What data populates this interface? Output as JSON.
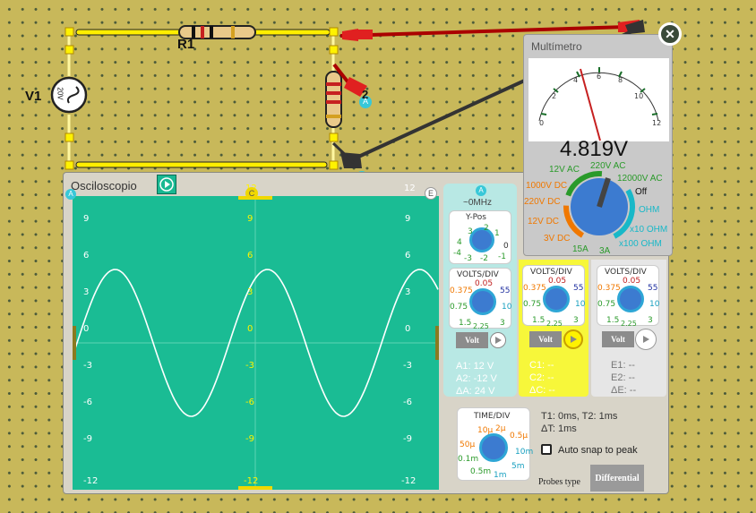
{
  "circuit": {
    "source": {
      "name": "V1",
      "value": "20V"
    },
    "resistor1": {
      "name": "R1"
    },
    "resistor2": {
      "name_partial": "2"
    },
    "probe_label": "A"
  },
  "oscilloscope": {
    "title": "Osciloscopio",
    "screen": {
      "left_ticks": [
        "9",
        "6",
        "3",
        "0",
        "-3",
        "-6",
        "-9",
        "-12"
      ],
      "center_ticks": [
        "12",
        "9",
        "6",
        "3",
        "0",
        "-3",
        "-6",
        "-9",
        "-12"
      ],
      "right_ticks": [
        "12",
        "9",
        "6",
        "3",
        "0",
        "-3",
        "-6",
        "-9",
        "-12"
      ],
      "left_marker": "A",
      "center_marker": "C",
      "right_marker": "E"
    },
    "channel_a": {
      "label": "A",
      "freq": "~0MHz",
      "ypos_title": "Y-Pos",
      "ypos_ticks": [
        "3",
        "2",
        "1",
        "4",
        "0",
        "-4",
        "-3",
        "-2",
        "-1"
      ],
      "volts_title": "VOLTS/DIV",
      "volts_ticks": [
        "0.05",
        "0.375",
        "55",
        "0.75",
        "10",
        "1.5",
        "2.25",
        "3"
      ],
      "btn": "Volt",
      "m1": "A1: 12 V",
      "m2": "A2: -12 V",
      "m3": "ΔA: 24 V"
    },
    "channel_c": {
      "volts_title": "VOLTS/DIV",
      "volts_ticks": [
        "0.05",
        "0.375",
        "55",
        "0.75",
        "10",
        "1.5",
        "2.25",
        "3"
      ],
      "btn": "Volt",
      "m1": "C1: --",
      "m2": "C2: --",
      "m3": "ΔC: --"
    },
    "channel_e": {
      "volts_title": "VOLTS/DIV",
      "volts_ticks": [
        "0.05",
        "0.375",
        "55",
        "0.75",
        "10",
        "1.5",
        "2.25",
        "3"
      ],
      "btn": "Volt",
      "m1": "E1: --",
      "m2": "E2: --",
      "m3": "ΔE: --"
    },
    "time": {
      "title": "TIME/DIV",
      "ticks": [
        "10µ",
        "2µ",
        "0.5µ",
        "50µ",
        "10m",
        "0.1m",
        "5m",
        "0.5m",
        "1m"
      ],
      "t_line": "T1: 0ms, T2: 1ms",
      "dt_line": "ΔT: 1ms",
      "snap_label": "Auto snap to peak",
      "probes_label": "Probes type",
      "probes_value": "Differential"
    },
    "colors": {
      "screen": "#1abc94",
      "trace": "#ffffff",
      "channel_a": "#b8e8e4",
      "channel_c": "#ffff66",
      "channel_e": "#e0e0e0"
    }
  },
  "multimeter": {
    "title": "Multímetro",
    "reading": "4.819V",
    "scale": [
      "0",
      "2",
      "4",
      "6",
      "8",
      "10",
      "12"
    ],
    "modes": [
      "12V AC",
      "220V AC",
      "1000V DC",
      "220V DC",
      "12V DC",
      "3V DC",
      "15A",
      "3A",
      "12000V AC",
      "Off",
      "OHM",
      "x10 OHM",
      "x100 OHM"
    ],
    "colors": {
      "dc": "#f07800",
      "ac": "#2a9a2a",
      "ohm": "#18b8c8"
    }
  }
}
